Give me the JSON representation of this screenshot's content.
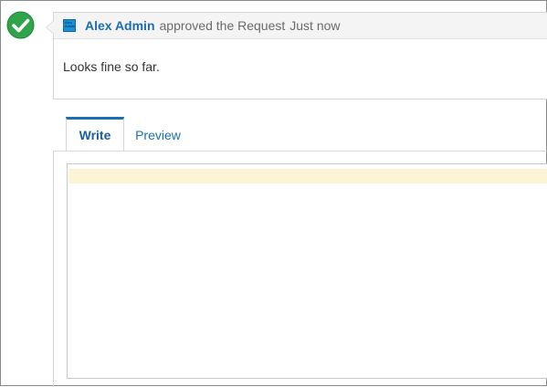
{
  "activity": {
    "status_icon": "check-circle-icon",
    "status_color": "#2fa44a",
    "avatar_text": "Alex Admin",
    "author": "Alex Admin",
    "action": "approved the Request",
    "timestamp": "Just now",
    "comment": "Looks fine so far."
  },
  "editor": {
    "tabs": [
      {
        "label": "Write",
        "active": true
      },
      {
        "label": "Preview",
        "active": false
      }
    ],
    "value": ""
  },
  "colors": {
    "link": "#1a6fb3",
    "header_bg": "#f4f4f4",
    "border": "#d6d6d6",
    "highlight": "#fdf4d6"
  }
}
